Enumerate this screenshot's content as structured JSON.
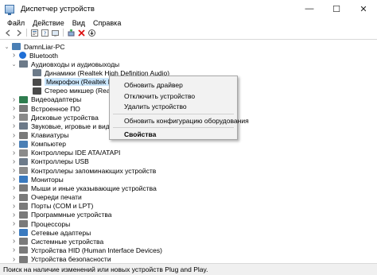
{
  "window": {
    "title": "Диспетчер устройств",
    "minimize_glyph": "—",
    "maximize_glyph": "☐",
    "close_glyph": "✕"
  },
  "menu": [
    "Файл",
    "Действие",
    "Вид",
    "Справка"
  ],
  "toolbar_icons": [
    "back-icon",
    "forward-icon",
    "properties-icon",
    "help-icon",
    "scan-icon",
    "update-driver-icon",
    "uninstall-icon",
    "enable-icon"
  ],
  "tree": [
    {
      "label": "DamnLiar-PC",
      "level": 0,
      "expander": "v",
      "icon": "computer-icon",
      "color": "#4a7fb5"
    },
    {
      "label": "Bluetooth",
      "level": 1,
      "expander": ">",
      "icon": "bluetooth-icon",
      "color": "#1f6fd6"
    },
    {
      "label": "Аудиовходы и аудиовыходы",
      "level": 1,
      "expander": "v",
      "icon": "audio-icon",
      "color": "#6c7a89"
    },
    {
      "label": "Динамики (Realtek High Definition Audio)",
      "level": 2,
      "expander": "",
      "icon": "speaker-icon",
      "color": "#6c7a89"
    },
    {
      "label": "Микрофон (Realtek High",
      "level": 2,
      "expander": "",
      "icon": "microphone-icon",
      "color": "#4a4a4a",
      "selected": true
    },
    {
      "label": "Стерео микшер (Realtek",
      "level": 2,
      "expander": "",
      "icon": "mixer-icon",
      "color": "#4a4a4a"
    },
    {
      "label": "Видеоадаптеры",
      "level": 1,
      "expander": ">",
      "icon": "display-adapter-icon",
      "color": "#2f7d4f"
    },
    {
      "label": "Встроенное ПО",
      "level": 1,
      "expander": ">",
      "icon": "firmware-icon",
      "color": "#7a7a7a"
    },
    {
      "label": "Дисковые устройства",
      "level": 1,
      "expander": ">",
      "icon": "disk-icon",
      "color": "#8a8a8a"
    },
    {
      "label": "Звуковые, игровые и видеоустройства",
      "level": 1,
      "expander": ">",
      "icon": "sound-icon",
      "color": "#6c7a89"
    },
    {
      "label": "Клавиатуры",
      "level": 1,
      "expander": ">",
      "icon": "keyboard-icon",
      "color": "#7a7a7a"
    },
    {
      "label": "Компьютер",
      "level": 1,
      "expander": ">",
      "icon": "computer-icon",
      "color": "#4a7fb5"
    },
    {
      "label": "Контроллеры IDE ATA/ATAPI",
      "level": 1,
      "expander": ">",
      "icon": "ide-controller-icon",
      "color": "#8a8a8a"
    },
    {
      "label": "Контроллеры USB",
      "level": 1,
      "expander": ">",
      "icon": "usb-icon",
      "color": "#6c7a89"
    },
    {
      "label": "Контроллеры запоминающих устройств",
      "level": 1,
      "expander": ">",
      "icon": "storage-controller-icon",
      "color": "#8a8a8a"
    },
    {
      "label": "Мониторы",
      "level": 1,
      "expander": ">",
      "icon": "monitor-icon",
      "color": "#3a7abf"
    },
    {
      "label": "Мыши и иные указывающие устройства",
      "level": 1,
      "expander": ">",
      "icon": "mouse-icon",
      "color": "#7a7a7a"
    },
    {
      "label": "Очереди печати",
      "level": 1,
      "expander": ">",
      "icon": "print-queue-icon",
      "color": "#7a7a7a"
    },
    {
      "label": "Порты (COM и LPT)",
      "level": 1,
      "expander": ">",
      "icon": "port-icon",
      "color": "#7a7a7a"
    },
    {
      "label": "Программные устройства",
      "level": 1,
      "expander": ">",
      "icon": "software-device-icon",
      "color": "#7a7a7a"
    },
    {
      "label": "Процессоры",
      "level": 1,
      "expander": ">",
      "icon": "processor-icon",
      "color": "#7a7a7a"
    },
    {
      "label": "Сетевые адаптеры",
      "level": 1,
      "expander": ">",
      "icon": "network-adapter-icon",
      "color": "#3a7abf"
    },
    {
      "label": "Системные устройства",
      "level": 1,
      "expander": ">",
      "icon": "system-device-icon",
      "color": "#7a7a7a"
    },
    {
      "label": "Устройства HID (Human Interface Devices)",
      "level": 1,
      "expander": ">",
      "icon": "hid-icon",
      "color": "#7a7a7a"
    },
    {
      "label": "Устройства безопасности",
      "level": 1,
      "expander": ">",
      "icon": "security-device-icon",
      "color": "#7a7a7a"
    }
  ],
  "context_menu": {
    "update_driver": "Обновить драйвер",
    "disable_device": "Отключить устройство",
    "uninstall_device": "Удалить устройство",
    "scan_hardware": "Обновить конфигурацию оборудования",
    "properties": "Свойства"
  },
  "statusbar": "Поиск на наличие изменений или новых устройств Plug and Play.",
  "colors": {
    "selection": "#cce8ff",
    "highlight_underline": "#e01a1a"
  }
}
